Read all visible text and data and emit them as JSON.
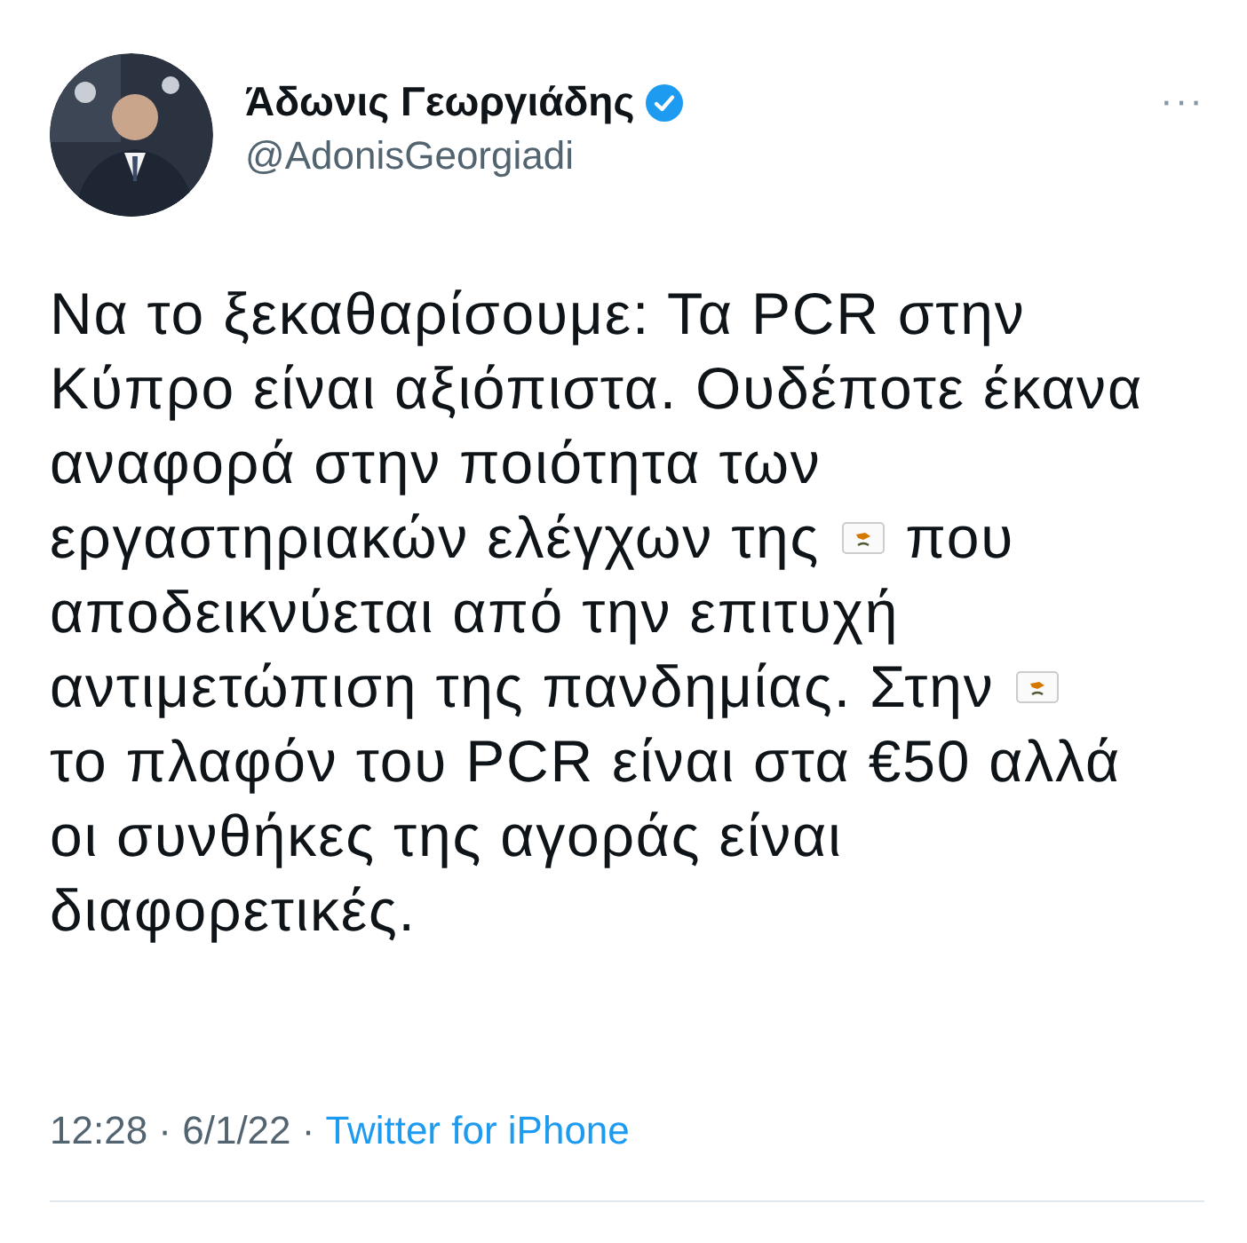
{
  "author": {
    "name": "Άδωνις Γεωργιάδης",
    "verified": true,
    "handle": "@AdonisGeorgiadi",
    "more": "···"
  },
  "tweet": {
    "lines": [
      [
        {
          "kind": "text",
          "text": "Να το ξεκαθαρίσουμε: Τα PCR στην"
        }
      ],
      [
        {
          "kind": "text",
          "text": "Κύπρο είναι αξιόπιστα. Ουδέποτε έκανα"
        }
      ],
      [
        {
          "kind": "text",
          "text": "αναφορά στην ποιότητα των"
        }
      ],
      [
        {
          "kind": "text",
          "text": "εργαστηριακών ελέγχων της"
        },
        {
          "kind": "flag"
        },
        {
          "kind": "text",
          "text": "που"
        }
      ],
      [
        {
          "kind": "text",
          "text": "αποδεικνύεται από την επιτυχή"
        }
      ],
      [
        {
          "kind": "text",
          "text": "αντιμετώπιση της πανδημίας. Στην"
        },
        {
          "kind": "flag"
        }
      ],
      [
        {
          "kind": "text",
          "text": "το πλαφόν του PCR είναι στα €50 αλλά"
        }
      ],
      [
        {
          "kind": "text",
          "text": "οι συνθήκες της αγοράς είναι"
        }
      ],
      [
        {
          "kind": "text",
          "text": "διαφορετικές."
        }
      ]
    ]
  },
  "footer": {
    "time": "12:28 · 6/1/22 ·",
    "source": "Twitter for iPhone"
  }
}
